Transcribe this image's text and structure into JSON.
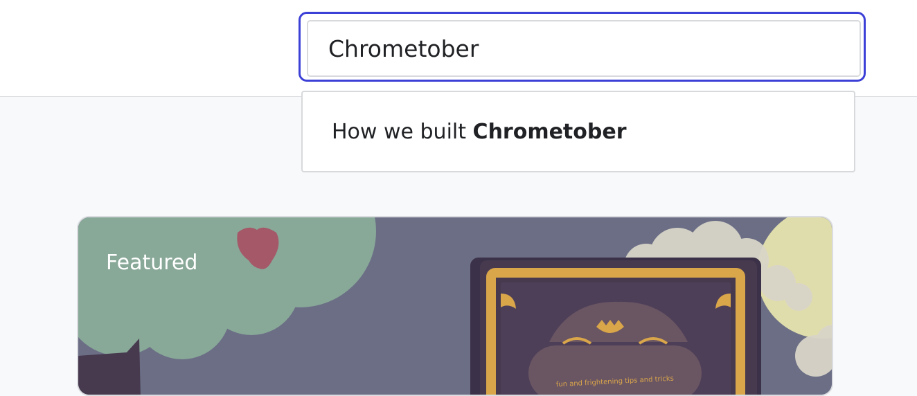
{
  "search": {
    "value": "Chrometober"
  },
  "suggestions": [
    {
      "prefix": "How we built ",
      "match": "Chrometober"
    }
  ],
  "featured": {
    "label": "Featured",
    "book_tagline": "fun and frightening tips and tricks"
  },
  "colors": {
    "focus_ring": "#3c40d6",
    "tree": "#88a898",
    "book": "#473a4f",
    "book_border": "#d9a64a",
    "moon": "#e0ddac",
    "card_bg": "#6b6e85"
  }
}
